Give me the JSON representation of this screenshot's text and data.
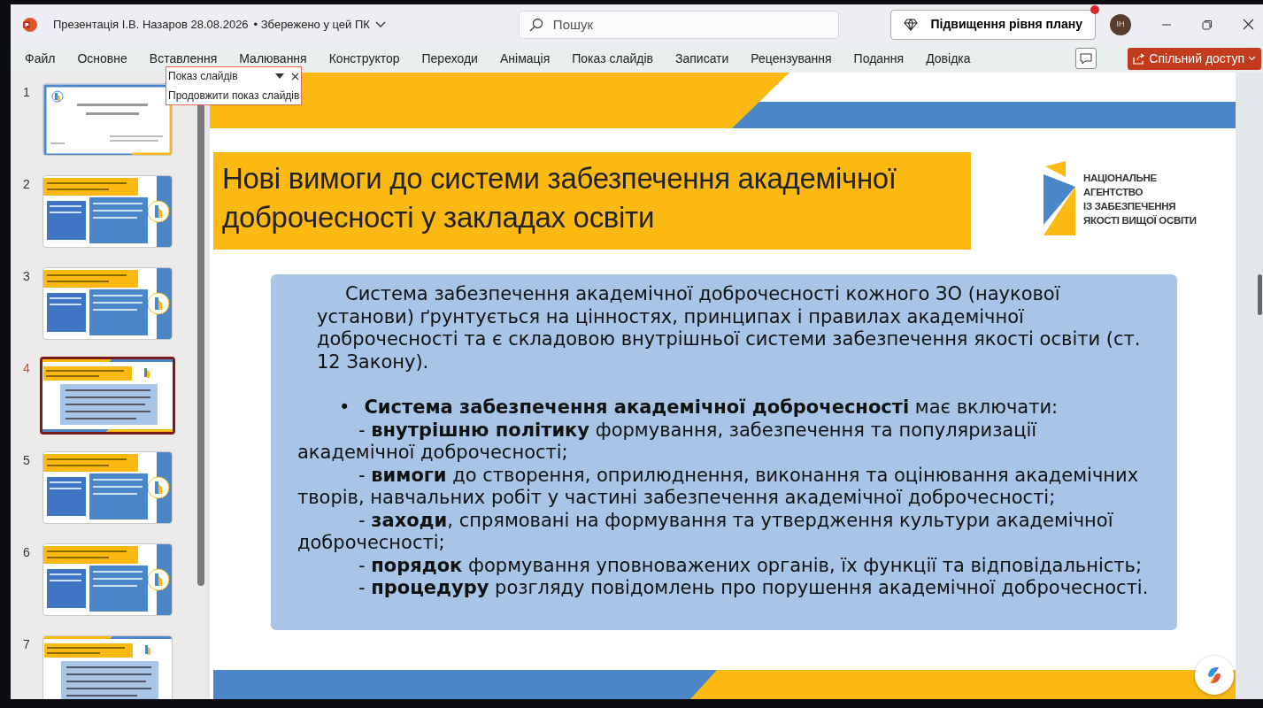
{
  "title_bar": {
    "document_title": "Презентація І.В. Назаров 28.08.2026",
    "save_status": "• Збережено у цей ПК",
    "search": {
      "placeholder": "Пошук"
    },
    "upgrade_button": {
      "label": "Підвищення рівня плану",
      "notification": true
    },
    "avatar": "ІН"
  },
  "menu": [
    "Файл",
    "Основне",
    "Вставлення",
    "Малювання",
    "Конструктор",
    "Переходи",
    "Анімація",
    "Показ слайдів",
    "Записати",
    "Рецензування",
    "Подання",
    "Довідка"
  ],
  "share_button": "Спільний доступ",
  "tooltip": {
    "title": "Показ слайдів",
    "item": "Продовжити показ слайдів"
  },
  "slides": [
    {
      "number": "1",
      "kind": "title",
      "selected": false
    },
    {
      "number": "2",
      "kind": "sidebar",
      "selected": false
    },
    {
      "number": "3",
      "kind": "sidebar",
      "selected": false
    },
    {
      "number": "4",
      "kind": "banded",
      "selected": true
    },
    {
      "number": "5",
      "kind": "sidebar",
      "selected": false
    },
    {
      "number": "6",
      "kind": "sidebar",
      "selected": false
    },
    {
      "number": "7",
      "kind": "banded",
      "selected": false
    }
  ],
  "slide": {
    "title_lines": [
      "Нові вимоги до системи забезпечення академічної",
      "доброчесності у закладах освіти"
    ],
    "logo_lines": [
      "НАЦІОНАЛЬНЕ",
      "АГЕНТСТВО",
      "ІЗ ЗАБЕЗПЕЧЕННЯ",
      "ЯКОСТІ ВИЩОЇ ОСВІТИ"
    ],
    "intro": "Система забезпечення академічної доброчесності кожного ЗО (наукової установи) ґрунтується на цінностях, принципах і правилах академічної доброчесності та є складовою внутрішньої системи забезпечення якості освіти (ст. 12 Закону).",
    "bullet_mark": "•",
    "bullet": "**Система забезпечення академічної доброчесності** має включати:",
    "items": [
      "- **внутрішню політику** формування, забезпечення та популяризації академічної доброчесності;",
      "- **вимоги** до створення, оприлюднення, виконання та оцінювання академічних творів, навчальних робіт у частині забезпечення академічної доброчесності;",
      "- **заходи**, спрямовані на формування та утвердження культури академічної доброчесності;",
      "- **порядок** формування уповноважених органів, їх функції та відповідальність;",
      "- **процедуру** розгляду повідомлень про порушення академічної доброчесності."
    ]
  }
}
